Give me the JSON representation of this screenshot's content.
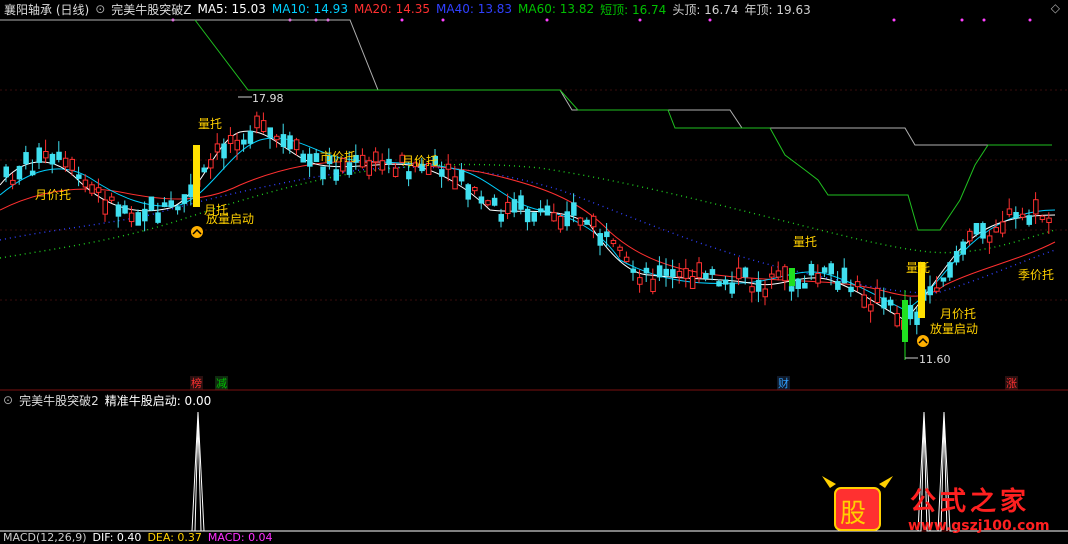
{
  "main_header": {
    "stock_name": "襄阳轴承 (日线)",
    "indicator_name": "完美牛股突破Z",
    "items": [
      {
        "label": "MA5: 15.03",
        "color": "#ffffff"
      },
      {
        "label": "MA10: 14.93",
        "color": "#00d0ff"
      },
      {
        "label": "MA20: 14.35",
        "color": "#ff3030"
      },
      {
        "label": "MA40: 13.83",
        "color": "#3040ff"
      },
      {
        "label": "MA60: 13.82",
        "color": "#00c000"
      },
      {
        "label": "短顶: 16.74",
        "color": "#00c000"
      },
      {
        "label": "头顶: 16.74",
        "color": "#d0d0d0"
      },
      {
        "label": "年顶: 19.63",
        "color": "#d0d0d0"
      }
    ]
  },
  "sub_header": {
    "indicator_name": "完美牛股突破2",
    "value_label": "精准牛股启动: 0.00"
  },
  "macd_header": {
    "items": [
      {
        "label": "MACD(12,26,9)",
        "color": "#cccccc"
      },
      {
        "label": "DIF: 0.40",
        "color": "#ffffff"
      },
      {
        "label": "DEA: 0.37",
        "color": "#ffd000"
      },
      {
        "label": "MACD: 0.04",
        "color": "#ff30ff"
      }
    ]
  },
  "annotations": {
    "high_price": "17.98",
    "low_price": "11.60",
    "yue_jia_tuo_left": "月价托",
    "liang_tuo_1": "量托",
    "yue_tuo_1": "月托",
    "fang_liang_1": "放量启动",
    "shi_jia_tuo": "市价托",
    "yue_jia_tuo_2": "月价托",
    "liang_tuo_2": "量托",
    "liang_tuo_3": "量托",
    "yue_jia_tuo_3": "月价托",
    "fang_liang_2": "放量启动",
    "ji_jia_tuo": "季价托"
  },
  "event_markers": [
    {
      "label": "榜",
      "color": "#ff3030"
    },
    {
      "label": "减",
      "color": "#00c000"
    },
    {
      "label": "财",
      "color": "#30a0ff"
    },
    {
      "label": "涨",
      "color": "#ff3030"
    }
  ],
  "watermark": {
    "text": "公式之家",
    "url": "www.gszj100.com"
  },
  "colors": {
    "up": "#ff3030",
    "down": "#40e0f0",
    "ma5": "#ffffff",
    "ma10": "#00d0ff",
    "ma20": "#ff3030",
    "ma60": "#00c000",
    "signal": "#ffe000"
  }
}
